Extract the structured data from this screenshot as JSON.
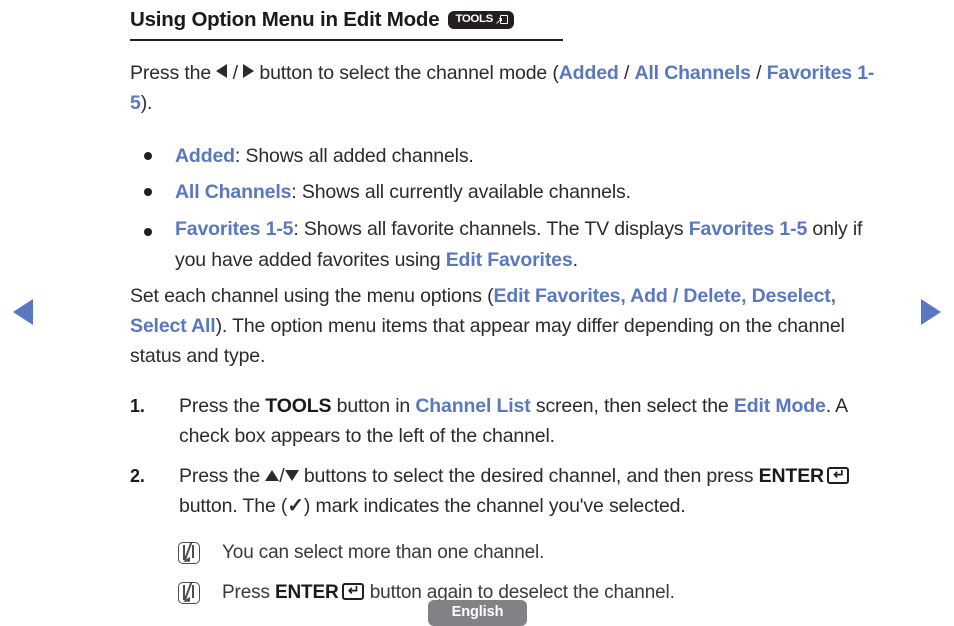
{
  "document": {
    "heading": {
      "title": "Using Option Menu in Edit Mode",
      "badge_label": "TOOLS",
      "badge_icon": "tools-arrow-box-icon"
    },
    "intro_paragraph": {
      "t1": "Press the ",
      "left_arrow_icon": "left-triangle-icon",
      "sep": " / ",
      "right_arrow_icon": "right-triangle-icon",
      "t2": " button to select the channel mode (",
      "mode_added": "Added",
      "slash1": " / ",
      "mode_all_channels": "All Channels",
      "slash2": " / ",
      "mode_favorites": "Favorites 1-5",
      "t3": ")."
    },
    "bullets": [
      {
        "term": "Added",
        "text": ": Shows all added channels."
      },
      {
        "term": "All Channels",
        "text": ": Shows all currently available channels."
      },
      {
        "term": "Favorites 1-5",
        "text_a": ": Shows all favorite channels. The TV displays ",
        "term_b": "Favorites 1-5",
        "text_b": " only if you have added favorites using ",
        "term_c": "Edit Favorites",
        "text_c": "."
      }
    ],
    "set_paragraph": {
      "t1": "Set each channel using the menu options (",
      "options": "Edit Favorites, Add / Delete, Deselect, Select All",
      "t2": "). The option menu items that appear may differ depending on the channel status and type."
    },
    "steps": [
      {
        "marker": "1.",
        "t1": "Press the ",
        "bold1": "TOOLS",
        "t2": " button in ",
        "blue1": "Channel List",
        "t3": " screen, then select the ",
        "blue2": "Edit Mode",
        "t4": ". A check box appears to the left of the channel."
      },
      {
        "marker": "2.",
        "t1": "Press the ",
        "up_arrow_icon": "up-triangle-icon",
        "arrow_sep": "/",
        "down_arrow_icon": "down-triangle-icon",
        "t2": " buttons to select the desired channel, and then press ",
        "bold1": "ENTER",
        "enter_icon": "enter-key-icon",
        "t3": " button. The (",
        "check_icon": "check-mark-icon",
        "t4": ") mark indicates the channel you've selected."
      }
    ],
    "notes": [
      {
        "icon": "note-pen-icon",
        "t1": "You can select more than one channel.",
        "bold1": "",
        "t2": ""
      },
      {
        "icon": "note-pen-icon",
        "t1": "Press ",
        "bold1": "ENTER",
        "enter_icon": "enter-key-icon",
        "t2": " button again to deselect the channel."
      }
    ],
    "footer": {
      "language_label": "English"
    },
    "navigation": {
      "prev_icon": "previous-page-arrow-icon",
      "next_icon": "next-page-arrow-icon"
    },
    "colors": {
      "link_blue": "#5a78bf",
      "text_black": "#2b2b2b",
      "badge_dark": "#231f20",
      "footer_gray": "#808285"
    }
  }
}
